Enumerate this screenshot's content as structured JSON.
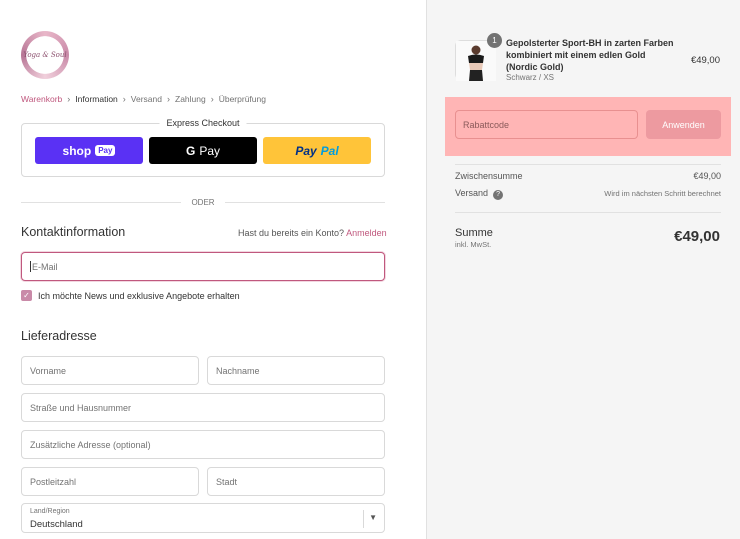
{
  "logo": {
    "text": "Yoga & Soul"
  },
  "breadcrumb": [
    {
      "label": "Warenkorb",
      "state": "link"
    },
    {
      "label": "Information",
      "state": "current"
    },
    {
      "label": "Versand",
      "state": "pending"
    },
    {
      "label": "Zahlung",
      "state": "pending"
    },
    {
      "label": "Überprüfung",
      "state": "pending"
    }
  ],
  "express": {
    "title": "Express Checkout",
    "shop_pay": {
      "label": "shop",
      "badge": "Pay"
    },
    "google_pay": {
      "g": "G",
      "label": "Pay"
    },
    "paypal": {
      "p": "Pay",
      "pal": "Pal"
    }
  },
  "divider_text": "ODER",
  "contact": {
    "heading": "Kontaktinformation",
    "login_question": "Hast du bereits ein Konto?",
    "login_link": "Anmelden",
    "email_placeholder": "E-Mail",
    "newsletter_label": "Ich möchte News und exklusive Angebote erhalten",
    "newsletter_checked": true
  },
  "shipping": {
    "heading": "Lieferadresse",
    "first_name": "Vorname",
    "last_name": "Nachname",
    "street": "Straße und Hausnummer",
    "address2": "Zusätzliche Adresse (optional)",
    "zip": "Postleitzahl",
    "city": "Stadt",
    "country_label": "Land/Region",
    "country_value": "Deutschland"
  },
  "summary": {
    "product": {
      "name": "Gepolsterter Sport-BH in zarten Farben kombiniert mit einem edlen Gold (Nordic Gold)",
      "variant": "Schwarz / XS",
      "price": "€49,00",
      "quantity": "1"
    },
    "discount_placeholder": "Rabattcode",
    "discount_button": "Anwenden",
    "subtotal_label": "Zwischensumme",
    "subtotal_value": "€49,00",
    "shipping_label": "Versand",
    "shipping_value": "Wird im nächsten Schritt berechnet",
    "total_label": "Summe",
    "total_sub": "inkl. MwSt.",
    "total_value": "€49,00"
  },
  "colors": {
    "accent": "#c0587e",
    "shop_pay": "#5a31f4",
    "paypal": "#ffc439",
    "highlight": "#ffb5b5"
  }
}
